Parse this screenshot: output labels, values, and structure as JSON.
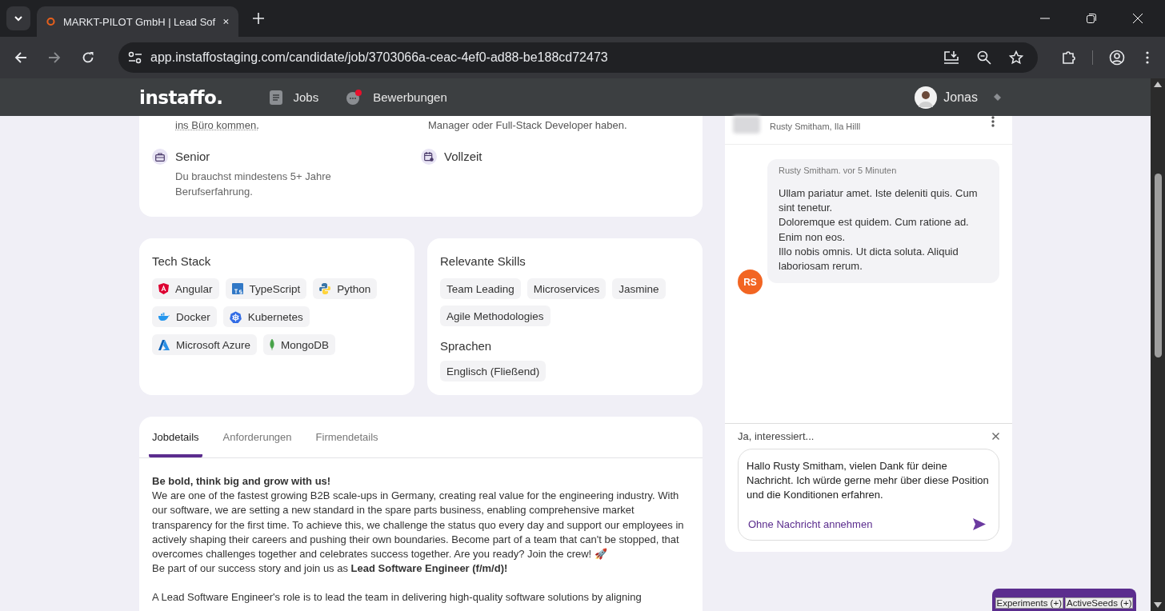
{
  "browser": {
    "tabs": [
      {
        "title": "MARKT-PILOT GmbH | Lead Sof",
        "selected": true
      }
    ],
    "url": "app.instaffostaging.com/candidate/job/3703066a-ceac-4ef0-ad88-be188cd72473"
  },
  "header": {
    "logo": "instaffo.",
    "nav": [
      {
        "label": "Jobs",
        "kind": "doc",
        "badge": false
      },
      {
        "label": "Bewerbungen",
        "kind": "chat",
        "badge": true
      }
    ],
    "user": "Jonas"
  },
  "overview": {
    "fragments": [
      {
        "text": "ins Büro kommen.",
        "underlined": true
      },
      {
        "text": "Manager oder Full-Stack Developer haben.",
        "underlined": false
      }
    ],
    "facts": [
      {
        "kind": "briefcase",
        "title": "Senior",
        "text": "Du brauchst mindestens 5+ Jahre Berufserfahrung."
      },
      {
        "kind": "calendar",
        "title": "Vollzeit"
      }
    ]
  },
  "tech_stack": {
    "title": "Tech Stack",
    "items": [
      {
        "label": "Angular",
        "kind": "angular"
      },
      {
        "label": "TypeScript",
        "kind": "typescript"
      },
      {
        "label": "Python",
        "kind": "python"
      },
      {
        "label": "Docker",
        "kind": "docker"
      },
      {
        "label": "Kubernetes",
        "kind": "kubernetes"
      },
      {
        "label": "Microsoft Azure",
        "kind": "azure"
      },
      {
        "label": "MongoDB",
        "kind": "mongodb"
      }
    ]
  },
  "skills": {
    "title": "Relevante Skills",
    "items": [
      "Team Leading",
      "Microservices",
      "Jasmine",
      "Agile Methodologies"
    ],
    "languages_title": "Sprachen",
    "languages": [
      "Englisch (Fließend)"
    ]
  },
  "details": {
    "tabs": [
      {
        "label": "Jobdetails",
        "selected": true
      },
      {
        "label": "Anforderungen",
        "selected": false
      },
      {
        "label": "Firmendetails",
        "selected": false
      }
    ],
    "sections": [
      [
        "**Be bold, think big and grow with us!**",
        "We are one of the fastest growing B2B scale-ups in Germany, creating real value for the engineering industry. With our software, we are setting a new standard in the spare parts business, enabling comprehensive market transparency for the first time. To achieve this, we challenge the status quo every day and support our employees in actively shaping their careers and pushing their own boundaries. Become part of a team that can't be stopped, that overcomes challenges together and celebrates success together. Are you ready? Join the crew! 🚀",
        "Be part of our success story and join us as **Lead Software Engineer (f/m/d)!**"
      ],
      [
        "A Lead Software Engineer's role is to lead the team in delivering high-quality software solutions by aligning"
      ]
    ]
  },
  "chat": {
    "participants": "Rusty Smitham, Ila Hilll",
    "messages": [
      {
        "meta": "Rusty Smitham. vor 5 Minuten",
        "initials": "RS",
        "lines": [
          "Ullam pariatur amet. Iste deleniti quis. Cum sint tenetur.",
          "Doloremque est quidem. Cum ratione ad.",
          "Enim non eos.",
          "Illo nobis omnis. Ut dicta soluta. Aliquid laboriosam rerum."
        ]
      }
    ],
    "reply": {
      "title": "Ja, interessiert...",
      "value": "Hallo Rusty Smitham, vielen Dank für deine Nachricht. Ich würde gerne mehr über diese Position und die Konditionen erfahren.",
      "link": "Ohne Nachricht annehmen"
    }
  },
  "dev_panel": {
    "buttons": [
      "Experiments (+)",
      "ActiveSeeds (+)"
    ]
  }
}
